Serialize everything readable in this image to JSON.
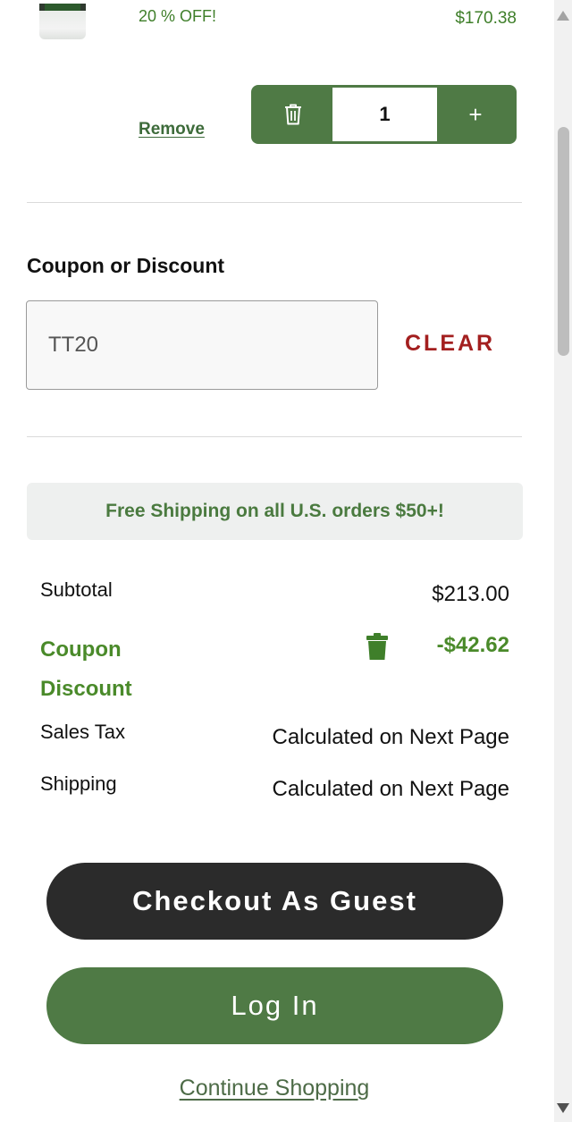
{
  "cart_item": {
    "discount_note": "20 % OFF!",
    "price": "$170.38",
    "remove_label": "Remove",
    "quantity": "1",
    "plus_symbol": "+"
  },
  "coupon": {
    "heading": "Coupon or Discount",
    "input_value": "TT20",
    "clear_label": "CLEAR"
  },
  "shipping_banner": "Free Shipping on all U.S. orders $50+!",
  "summary": {
    "subtotal_label": "Subtotal",
    "subtotal_value": "$213.00",
    "coupon_label": "Coupon Discount",
    "coupon_value": "-$42.62",
    "tax_label": "Sales Tax",
    "tax_value": "Calculated on Next Page",
    "shipping_label": "Shipping",
    "shipping_value": "Calculated on Next Page"
  },
  "actions": {
    "guest_checkout": "Checkout As Guest",
    "login": "Log In",
    "continue_shopping": "Continue Shopping"
  },
  "colors": {
    "brand_green": "#4f7a45",
    "discount_green": "#4a8a2a",
    "clear_red": "#a31f1f",
    "dark_button": "#2b2b2b"
  },
  "icons": {
    "quantity_delete": "trash-icon",
    "coupon_remove": "trash-can-solid-icon"
  }
}
